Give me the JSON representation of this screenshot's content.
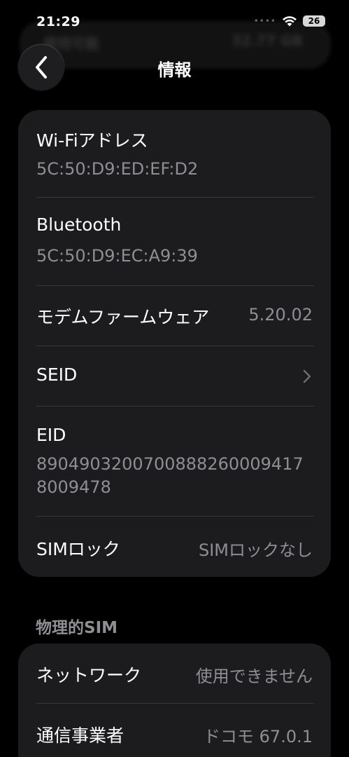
{
  "status_bar": {
    "time": "21:29",
    "battery": "26"
  },
  "background_ghost": {
    "left_text": "使用可能",
    "right_text": "32.77 GB"
  },
  "nav": {
    "title": "情報"
  },
  "info_card": {
    "wifi_label": "Wi-Fiアドレス",
    "wifi_value": "5C:50:D9:ED:EF:D2",
    "bluetooth_label": "Bluetooth",
    "bluetooth_value": "5C:50:D9:EC:A9:39",
    "modem_label": "モデムファームウェア",
    "modem_value": "5.20.02",
    "seid_label": "SEID",
    "eid_label": "EID",
    "eid_value_line1": "89049032007008882600094​17",
    "eid_value_line2": "8009478",
    "simlock_label": "SIMロック",
    "simlock_value": "SIMロックなし"
  },
  "physical_sim": {
    "header": "物理的SIM",
    "network_label": "ネットワーク",
    "network_value": "使用できません",
    "carrier_label": "通信事業者",
    "carrier_value": "ドコモ 67.0.1"
  },
  "colors": {
    "background": "#000000",
    "card": "#1c1c1e",
    "separator": "#38383a",
    "secondary_text": "#8e8e93"
  }
}
